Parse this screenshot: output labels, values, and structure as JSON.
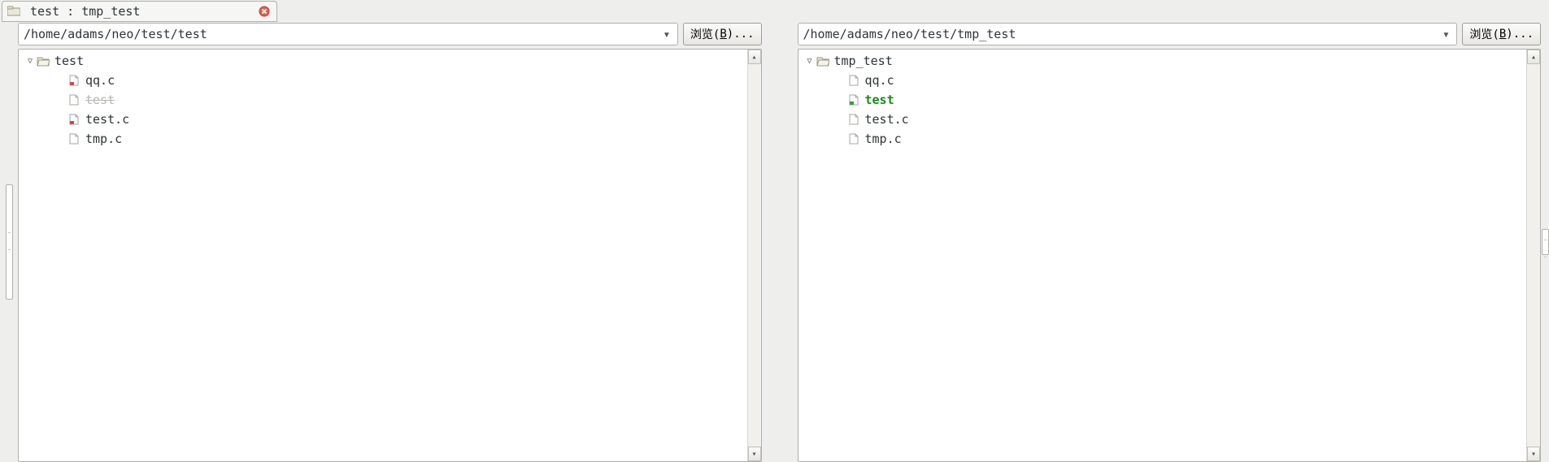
{
  "tab": {
    "title": "test : tmp_test"
  },
  "browse": {
    "prefix": "浏览(",
    "accel": "B",
    "suffix": ")..."
  },
  "left": {
    "path": "/home/adams/neo/test/test",
    "root": {
      "name": "test"
    },
    "items": [
      {
        "name": "qq.c",
        "style": "normal",
        "icon": "file-diff"
      },
      {
        "name": "test",
        "style": "deleted",
        "icon": "file"
      },
      {
        "name": "test.c",
        "style": "normal",
        "icon": "file-diff"
      },
      {
        "name": "tmp.c",
        "style": "normal",
        "icon": "file"
      }
    ]
  },
  "right": {
    "path": "/home/adams/neo/test/tmp_test",
    "root": {
      "name": "tmp_test"
    },
    "items": [
      {
        "name": "qq.c",
        "style": "normal",
        "icon": "file"
      },
      {
        "name": "test",
        "style": "added",
        "icon": "file-add"
      },
      {
        "name": "test.c",
        "style": "normal",
        "icon": "file"
      },
      {
        "name": "tmp.c",
        "style": "normal",
        "icon": "file"
      }
    ]
  }
}
